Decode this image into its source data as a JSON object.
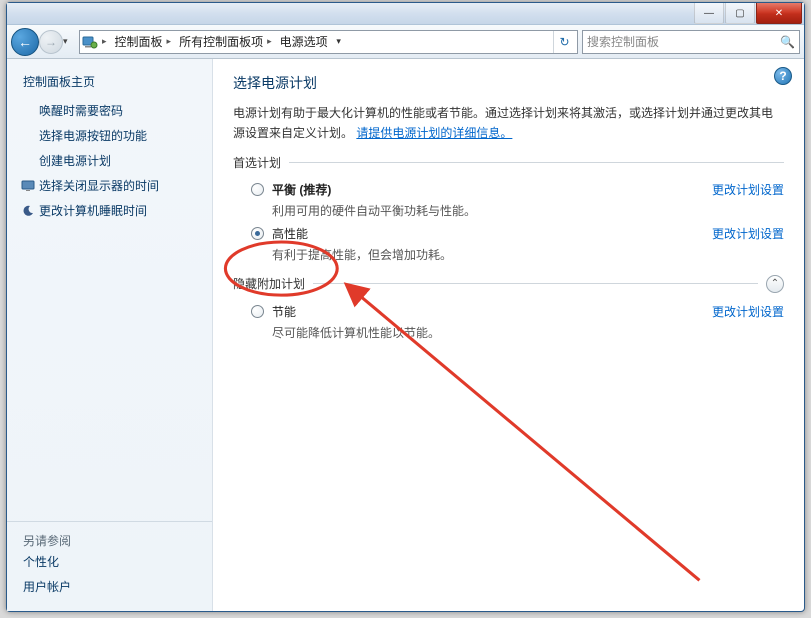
{
  "titlebar": {
    "minimize": "—",
    "maximize": "▢",
    "close": "✕"
  },
  "nav": {
    "back": "←",
    "forward": "→",
    "dropdown": "▾"
  },
  "breadcrumb": {
    "root_chev": "▸",
    "node1": "控制面板",
    "node2": "所有控制面板项",
    "node3": "电源选项",
    "chev": "▸",
    "refresh": "↻",
    "refresh_dd": "▾"
  },
  "search": {
    "placeholder": "搜索控制面板",
    "icon": "🔍"
  },
  "sidebar": {
    "heading": "控制面板主页",
    "items": [
      {
        "label": "唤醒时需要密码"
      },
      {
        "label": "选择电源按钮的功能"
      },
      {
        "label": "创建电源计划"
      },
      {
        "label": "选择关闭显示器的时间",
        "icon": "monitor"
      },
      {
        "label": "更改计算机睡眠时间",
        "icon": "moon"
      }
    ],
    "footer_heading": "另请参阅",
    "footer_links": [
      {
        "label": "个性化"
      },
      {
        "label": "用户帐户"
      }
    ]
  },
  "main": {
    "help": "?",
    "title": "选择电源计划",
    "description_pre": "电源计划有助于最大化计算机的性能或者节能。通过选择计划来将其激活，或选择计划并通过更改其电源设置来自定义计划。",
    "description_link": "请提供电源计划的详细信息。",
    "section_preferred": "首选计划",
    "section_hidden": "隐藏附加计划",
    "change_link": "更改计划设置",
    "plans_preferred": [
      {
        "id": "balanced",
        "title": "平衡 (推荐)",
        "bold": true,
        "checked": false,
        "sub": "利用可用的硬件自动平衡功耗与性能。"
      },
      {
        "id": "highperf",
        "title": "高性能",
        "bold": false,
        "checked": true,
        "sub": "有利于提高性能，但会增加功耗。"
      }
    ],
    "plans_hidden": [
      {
        "id": "saver",
        "title": "节能",
        "bold": false,
        "checked": false,
        "sub": "尽可能降低计算机性能以节能。"
      }
    ],
    "expand": "⌃"
  }
}
